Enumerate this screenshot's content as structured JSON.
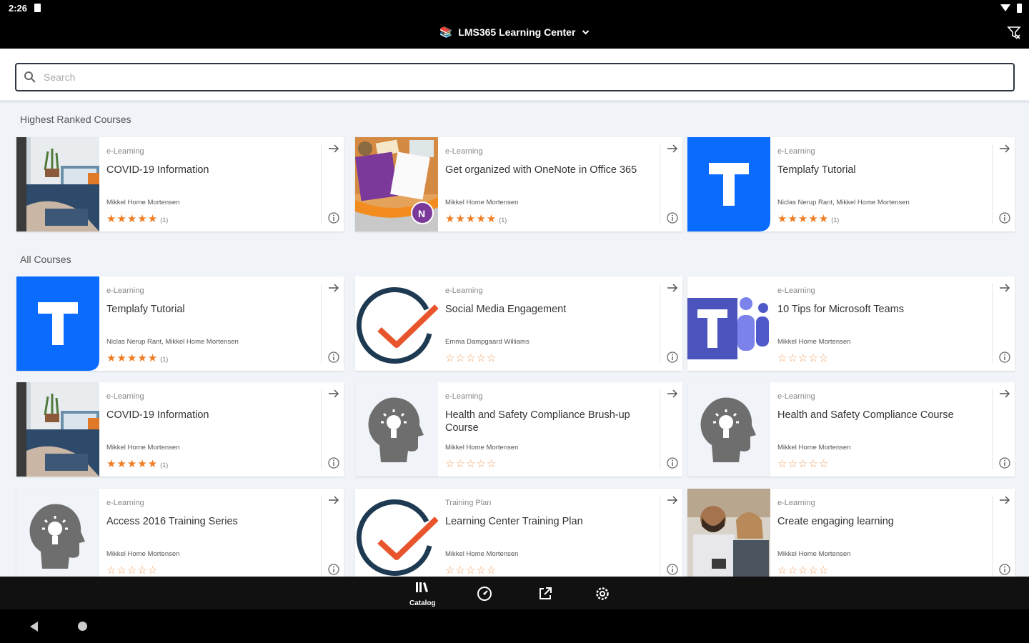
{
  "status_bar": {
    "time": "2:26"
  },
  "app_bar": {
    "title": "LMS365 Learning Center"
  },
  "search": {
    "placeholder": "Search"
  },
  "sections": {
    "highest_ranked": "Highest Ranked Courses",
    "all_courses": "All Courses"
  },
  "highest_ranked_courses": [
    {
      "type": "e-Learning",
      "title": "COVID-19 Information",
      "authors": "Mikkel Home Mortensen",
      "rating": 5,
      "rating_count": "(1)",
      "thumb": "office-photo"
    },
    {
      "type": "e-Learning",
      "title": "Get organized with OneNote in Office 365",
      "authors": "Mikkel Home Mortensen",
      "rating": 5,
      "rating_count": "(1)",
      "thumb": "onenote"
    },
    {
      "type": "e-Learning",
      "title": "Templafy Tutorial",
      "authors": "Niclas Nerup Rant, Mikkel Home Mortensen",
      "rating": 5,
      "rating_count": "(1)",
      "thumb": "templafy"
    }
  ],
  "all_courses": [
    {
      "type": "e-Learning",
      "title": "Templafy Tutorial",
      "authors": "Niclas Nerup Rant, Mikkel Home Mortensen",
      "rating": 5,
      "rating_count": "(1)",
      "thumb": "templafy"
    },
    {
      "type": "e-Learning",
      "title": "Social Media Engagement",
      "authors": "Emma Dampgaard Williams",
      "rating": 0,
      "rating_count": "",
      "thumb": "check"
    },
    {
      "type": "e-Learning",
      "title": "10 Tips for Microsoft Teams",
      "authors": "Mikkel Home Mortensen",
      "rating": 0,
      "rating_count": "",
      "thumb": "teams"
    },
    {
      "type": "e-Learning",
      "title": "COVID-19 Information",
      "authors": "Mikkel Home Mortensen",
      "rating": 5,
      "rating_count": "(1)",
      "thumb": "office-photo"
    },
    {
      "type": "e-Learning",
      "title": "Health and Safety Compliance Brush-up Course",
      "authors": "Mikkel Home Mortensen",
      "rating": 0,
      "rating_count": "",
      "thumb": "head-bulb"
    },
    {
      "type": "e-Learning",
      "title": "Health and Safety Compliance Course",
      "authors": "Mikkel Home Mortensen",
      "rating": 0,
      "rating_count": "",
      "thumb": "head-bulb"
    },
    {
      "type": "e-Learning",
      "title": "Access 2016 Training Series",
      "authors": "Mikkel Home Mortensen",
      "rating": 0,
      "rating_count": "",
      "thumb": "head-bulb"
    },
    {
      "type": "Training Plan",
      "title": "Learning Center Training Plan",
      "authors": "Mikkel Home Mortensen",
      "rating": 0,
      "rating_count": "",
      "thumb": "check"
    },
    {
      "type": "e-Learning",
      "title": "Create engaging learning",
      "authors": "Mikkel Home Mortensen",
      "rating": 0,
      "rating_count": "",
      "thumb": "people-photo"
    }
  ],
  "bottom_nav": {
    "items": [
      {
        "label": "Catalog",
        "icon": "catalog-icon",
        "active": true
      },
      {
        "label": "",
        "icon": "dashboard-icon",
        "active": false
      },
      {
        "label": "",
        "icon": "external-link-icon",
        "active": false
      },
      {
        "label": "",
        "icon": "settings-icon",
        "active": false
      }
    ]
  },
  "colors": {
    "accent": "#f07c22",
    "templafy_blue": "#0a6cff",
    "teams_purple": "#4b53bc",
    "check_navy": "#1e3a52",
    "background": "#f0f4f8"
  }
}
